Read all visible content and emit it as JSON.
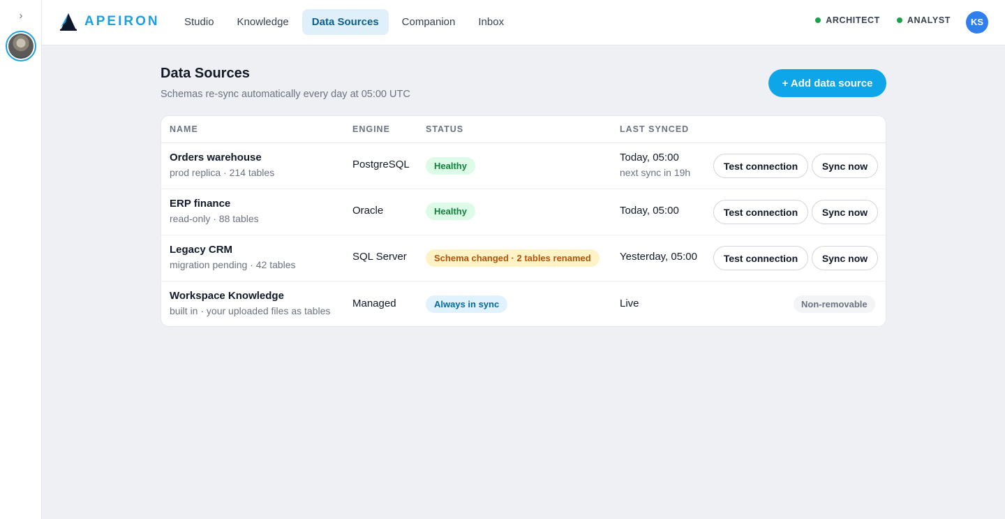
{
  "rail": {
    "toggle_glyph": "›"
  },
  "brand": {
    "name": "APEIRON"
  },
  "nav": {
    "items": [
      {
        "label": "Studio",
        "active": false
      },
      {
        "label": "Knowledge",
        "active": false
      },
      {
        "label": "Data Sources",
        "active": true
      },
      {
        "label": "Companion",
        "active": false
      },
      {
        "label": "Inbox",
        "active": false
      }
    ]
  },
  "roles": [
    {
      "label": "ARCHITECT",
      "color": "#16a34a"
    },
    {
      "label": "ANALYST",
      "color": "#16a34a"
    }
  ],
  "user": {
    "initials": "KS"
  },
  "page": {
    "title": "Data Sources",
    "subtitle": "Schemas re-sync automatically every day at 05:00 UTC",
    "add_button": "+ Add data source"
  },
  "table": {
    "headers": {
      "name": "NAME",
      "engine": "ENGINE",
      "status": "STATUS",
      "last_synced": "LAST SYNCED"
    },
    "rows": [
      {
        "name": "Orders warehouse",
        "detail": "prod replica · 214 tables",
        "engine": "PostgreSQL",
        "status": "Healthy",
        "status_kind": "healthy",
        "last_synced": "Today, 05:00",
        "last_synced_sub": "next sync in 19h",
        "test_label": "Test connection",
        "sync_label": "Sync now"
      },
      {
        "name": "ERP finance",
        "detail": "read-only · 88 tables",
        "engine": "Oracle",
        "status": "Healthy",
        "status_kind": "healthy",
        "last_synced": "Today, 05:00",
        "test_label": "Test connection",
        "sync_label": "Sync now"
      },
      {
        "name": "Legacy CRM",
        "detail": "migration pending · 42 tables",
        "engine": "SQL Server",
        "status": "Schema changed · 2 tables renamed",
        "status_kind": "warn",
        "last_synced": "Yesterday, 05:00",
        "test_label": "Test connection",
        "sync_label": "Sync now"
      },
      {
        "name": "Workspace Knowledge",
        "detail": "built in · your uploaded files as tables",
        "engine": "Managed",
        "status": "Always in sync",
        "status_kind": "sync",
        "last_synced": "Live",
        "tag": "Non-removable"
      }
    ]
  },
  "colors": {
    "accent": "#0ea5e9",
    "brand": "#1ba1e2",
    "healthy": "#15803d",
    "warning": "#b45309",
    "info": "#0369a1"
  }
}
